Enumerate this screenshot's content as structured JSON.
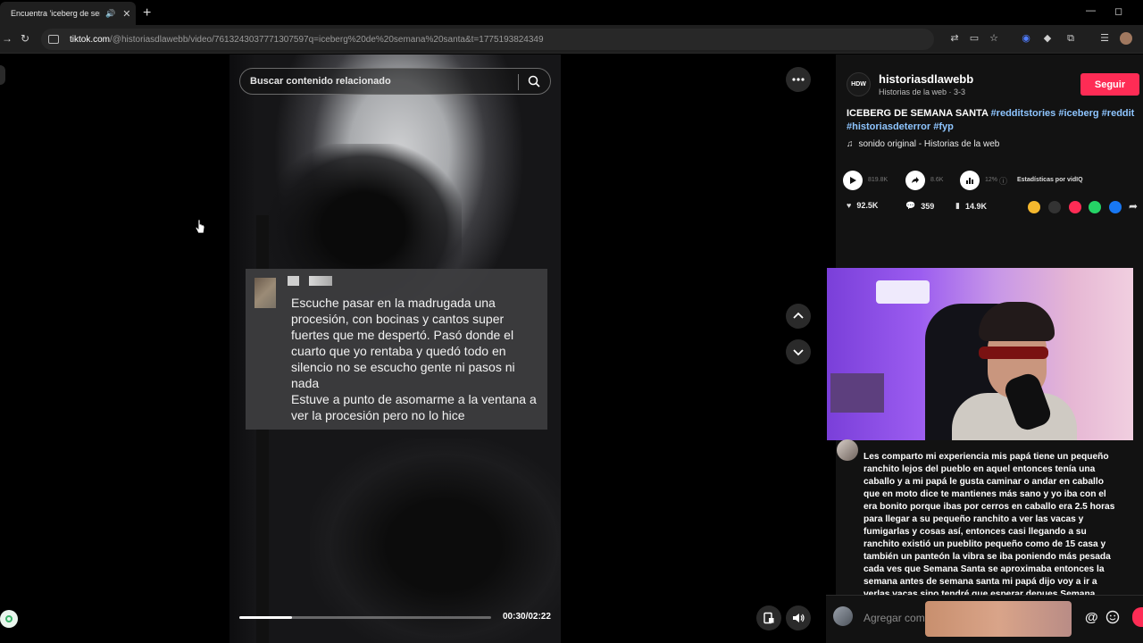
{
  "browser": {
    "tab_title": "Encuentra 'iceberg de sema",
    "tab_audio_icon": "speaker-icon",
    "new_tab": "+",
    "min": "—",
    "restore": "◻",
    "url_host": "tiktok.com",
    "url_path": "/@historiasdlawebb/video/7613243037771307597q=iceberg%20de%20semana%20santa&t=1775193824349"
  },
  "video": {
    "search_placeholder": "Buscar contenido relacionado",
    "quote_text": "Escuche pasar en la madrugada una procesión, con bocinas y cantos super fuertes que me despertó.  Pasó donde el cuarto que yo rentaba y quedó todo en silencio no se escucho gente ni pasos ni nada\nEstuve a punto de asomarme a la ventana a ver la procesión pero no lo hice",
    "progress_fraction": 0.21,
    "time": "00:30/02:22"
  },
  "panel": {
    "logo_text": "HDW",
    "username": "historiasdlawebb",
    "subline": "Historias de la web · 3-3",
    "follow": "Seguir",
    "desc_title": "ICEBERG DE SEMANA SANTA ",
    "tags": [
      "#redditstories",
      "#iceberg",
      "#reddit",
      "#historiasdeterror",
      "#fyp"
    ],
    "sound": "sonido original - Historias de la web",
    "stats": {
      "views": "819.8K",
      "shares_small": "8.6K",
      "percent": "12%",
      "label": "Estadísticas por vidIQ"
    },
    "actions": {
      "likes": "92.5K",
      "comments": "359",
      "saves": "14.9K"
    },
    "comment_text": "Les comparto mi experiencia mis papá tiene un pequeño ranchito lejos del pueblo en aquel entonces tenía una caballo y a mi papá le gusta caminar o andar en caballo que en moto dice te mantienes más sano y yo iba con el era bonito porque ibas por cerros en caballo era 2.5 horas para llegar a su pequeño ranchito a ver las vacas y fumigarlas y cosas así, entonces casi llegando a su ranchito existió un pueblito pequeño como de 15 casa y también un panteón la vibra se iba poniendo más pesada cada ves que Semana Santa se aproximaba entonces la semana antes de semana santa mi papá dijo voy a ir a verlas vacas sino tendré que esperar depues Semana Santa entonces fui con el llegando a la entrada de pueblito el caballo se queda parado viendo hacia enfrente del camino, entonces escuchamos paso de alguien en las viniendo hacia nosotros (se escuchaba como pisaba en las",
    "comment_placeholder": "Agregar com",
    "at_symbol": "@"
  },
  "colors": {
    "accent": "#fe2c55",
    "tag": "#8ec5ff"
  }
}
